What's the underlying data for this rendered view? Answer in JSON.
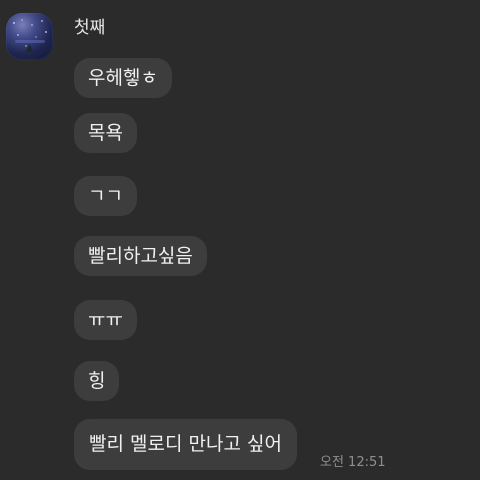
{
  "chat": {
    "sender": {
      "name": "첫째",
      "avatar_icon": "profile-photo-night-sky"
    },
    "messages": [
      {
        "text": "우헤헿ㅎ"
      },
      {
        "text": "목욕"
      },
      {
        "text": "ㄱㄱ"
      },
      {
        "text": "빨리하고싶음"
      },
      {
        "text": "ㅠㅠ"
      },
      {
        "text": "힝"
      },
      {
        "text": "빨리 멜로디 만나고 싶어"
      }
    ],
    "timestamp": "오전 12:51"
  },
  "colors": {
    "background": "#2b2b2b",
    "bubble": "#3d3d3d",
    "text": "#f0f0f0",
    "timestamp": "#8f8f8f"
  }
}
